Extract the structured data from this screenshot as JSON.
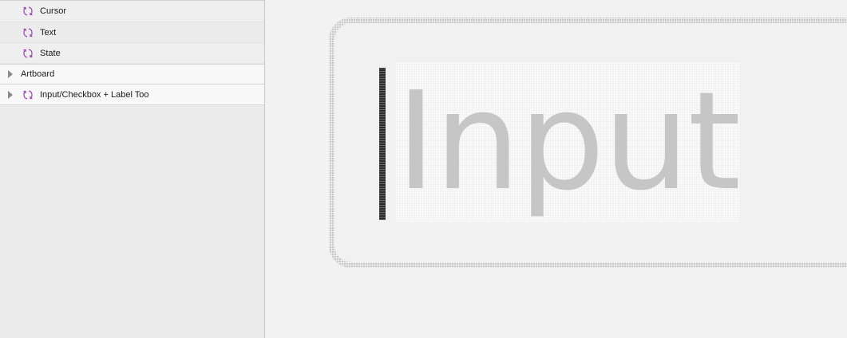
{
  "layers_panel": {
    "items": [
      {
        "label": "Cursor",
        "icon": "symbol-instance-icon",
        "level": "child"
      },
      {
        "label": "Text",
        "icon": "symbol-instance-icon",
        "level": "child"
      },
      {
        "label": "State",
        "icon": "symbol-instance-icon",
        "level": "child"
      },
      {
        "label": "Artboard",
        "icon": "",
        "level": "top"
      },
      {
        "label": "Input/Checkbox + Label Too",
        "icon": "symbol-instance-icon",
        "level": "top"
      }
    ]
  },
  "canvas": {
    "placeholder_text": "Input"
  },
  "colors": {
    "symbol_icon": "#9b4fb3",
    "cursor": "#2e2e2e",
    "placeholder": "#c6c6c6",
    "input_border": "#c9c9c9"
  }
}
